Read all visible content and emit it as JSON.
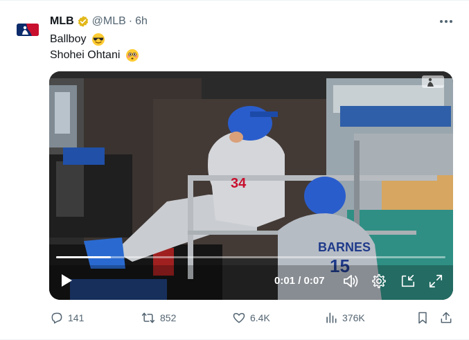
{
  "tweet": {
    "display_name": "MLB",
    "handle": "@MLB",
    "separator": "·",
    "time": "6h",
    "avatar_icon": "mlb-logo-icon",
    "verified_badge_color": "#e2b719",
    "text_line1": "Ballboy",
    "text_line2": "Shohei Ohtani",
    "emoji_line1": "smiling-face-with-sunglasses-icon",
    "emoji_line2": "flushed-face-icon"
  },
  "video": {
    "current_time": "0:01",
    "duration": "0:07",
    "time_separator": "/",
    "progress": 0.14,
    "jersey_number_front": "34",
    "jersey_name_back": "BARNES",
    "jersey_number_back": "15"
  },
  "actions": {
    "replies": "141",
    "reposts": "852",
    "likes": "6.4K",
    "views": "376K"
  },
  "colors": {
    "text_primary": "#0f1419",
    "text_secondary": "#536471",
    "mlb_blue": "#0b2b6b",
    "mlb_red": "#c8102e",
    "dodgers_blue": "#1a5bc4"
  }
}
